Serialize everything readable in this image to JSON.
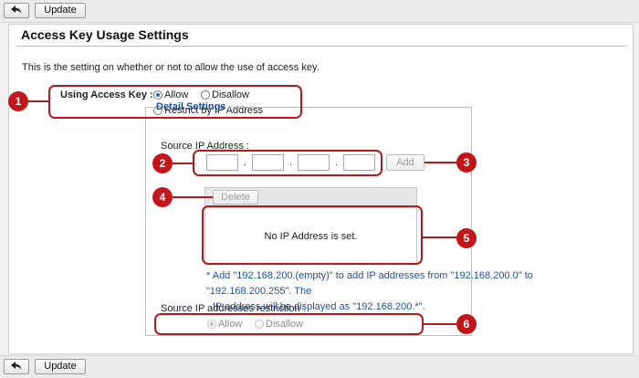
{
  "toolbar": {
    "update_label": "Update",
    "back_icon": "back-arrow-icon"
  },
  "page": {
    "title": "Access Key Usage Settings",
    "description": "This is the setting on whether or not to allow the use of access key."
  },
  "usage": {
    "label": "Using Access Key :",
    "options": [
      "Allow",
      "Disallow",
      "Restrict by IP Address"
    ],
    "selected": "Allow"
  },
  "detail": {
    "legend": "Detail Settings",
    "source_ip_label": "Source IP Address :",
    "ip_separator": ".",
    "ip_octets": [
      "",
      "",
      "",
      ""
    ],
    "add_label": "Add",
    "delete_label": "Delete",
    "empty_text": "No IP Address is set.",
    "note_line1": "* Add \"192.168.200.(empty)\" to add IP addresses from \"192.168.200.0\" to \"192.168.200.255\". The",
    "note_line2": "IP address will be displayed as \"192.168.200.*\".",
    "restriction_label": "Source IP addresses restriction :",
    "restriction_options": [
      "Allow",
      "Disallow"
    ],
    "restriction_selected": "Allow"
  },
  "annotations": [
    "1",
    "2",
    "3",
    "4",
    "5",
    "6"
  ],
  "colors": {
    "annotation": "#c2161b",
    "link_blue": "#1e4f9a",
    "radio_selected": "#1a62c8"
  }
}
